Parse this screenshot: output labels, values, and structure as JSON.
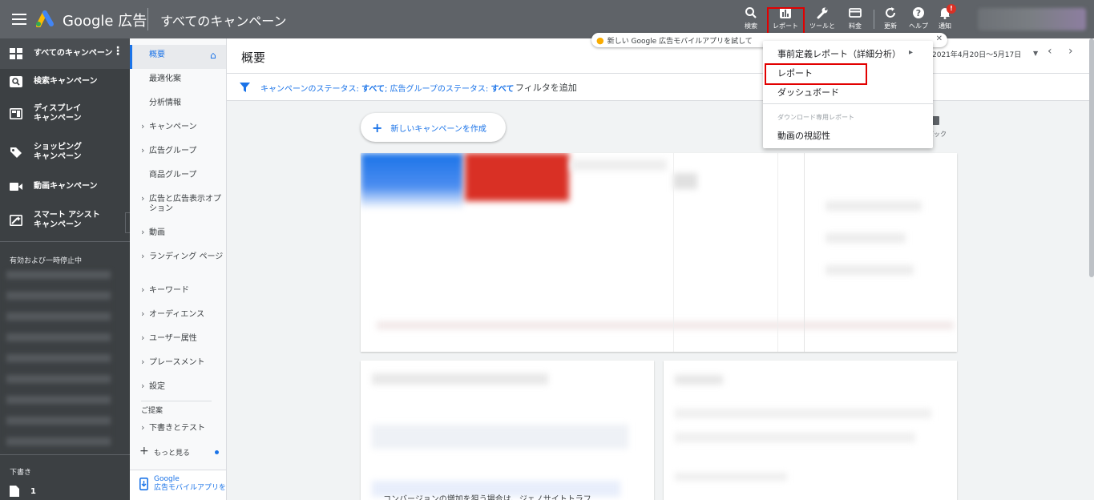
{
  "app": {
    "brand": "Google 広告",
    "campaign_scope": "すべてのキャンペーン"
  },
  "toolbar": {
    "search_label": "検索",
    "reports_label": "レポート",
    "tools_label": "ツールと",
    "billing_label": "料金",
    "refresh_label": "更新",
    "help_label": "ヘルプ",
    "notifications_label": "通知",
    "notification_badge": "!"
  },
  "left_nav": {
    "items": [
      {
        "label": "すべてのキャンペーン"
      },
      {
        "label": "検索キャンペーン"
      },
      {
        "label": "ディスプレイ\nキャンペーン"
      },
      {
        "label": "ショッピング\nキャンペーン"
      },
      {
        "label": "動画キャンペーン"
      },
      {
        "label": "スマート アシスト\nキャンペーン"
      }
    ],
    "section_label": "有効および一時停止中",
    "drafts_label": "下書き",
    "drafts_count": "1"
  },
  "sub_nav": {
    "items": [
      "概要",
      "最適化案",
      "分析情報",
      "キャンペーン",
      "広告グループ",
      "商品グループ",
      "広告と広告表示オプション",
      "動画",
      "ランディング ページ",
      "キーワード",
      "オーディエンス",
      "ユーザー属性",
      "プレースメント",
      "設定"
    ],
    "suggestions_label": "ご提案",
    "drafts_label": "下書きとテスト",
    "more_label": "もっと見る",
    "app_promo": "Google\n広告モバイルアプリを"
  },
  "page": {
    "title": "概要",
    "filter_prefix": "キャンペーンのステータス: ",
    "filter_value1": "すべて",
    "filter_mid": "; 広告グループのステータス: ",
    "filter_value2": "すべて",
    "filter_add": "フィルタを追加",
    "date_range": "2021年4月20日～5月17日",
    "new_campaign": "新しいキャンペーンを作成",
    "feedback": "バック",
    "card_text": "コンバージョンの増加を狙う場合は、ジェノサイトトラフ"
  },
  "tooltip": {
    "text": "新しい Google 広告モバイルアプリを試して"
  },
  "dropdown": {
    "items": [
      "事前定義レポート（詳細分析）",
      "レポート",
      "ダッシュボード"
    ],
    "section_label": "ダウンロード専用レポート",
    "download_items": [
      "動画の視認性"
    ]
  },
  "colors": {
    "topbar": "#5f6368",
    "leftnav": "#3c4043",
    "accent": "#1a73e8",
    "highlight": "#e20000"
  }
}
